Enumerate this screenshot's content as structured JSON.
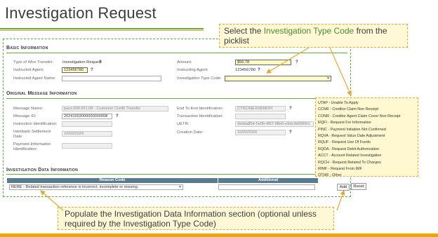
{
  "slide": {
    "title": "Investigation Request",
    "callout_top_prefix": "Select the ",
    "callout_top_highlight": "Investigation Type Code",
    "callout_top_suffix": " from the picklist",
    "callout_bottom": "Populate the Investigation Data Information section (optional unless required by the Investigation Type Code)"
  },
  "basic": {
    "title": "Basic Information",
    "type_label": "Type of Wire Transfer:",
    "type_value": "Investigation Request",
    "instructed_agent_label": "Instructed Agent:",
    "instructed_agent_value": "123456780",
    "instructed_agent_name_label": "Instructed Agent Name:",
    "amount_label": "Amount:",
    "amount_value": "$56.78",
    "instructing_agent_label": "Instructing Agent:",
    "instructing_agent_value": "123456780",
    "inv_type_label": "Investigation Type Code:",
    "help": "?"
  },
  "original": {
    "title": "Original Message Information",
    "message_name_label": "Message Name:",
    "message_name_value": "pacs.008.001.08 - Customer Credit Transfer",
    "message_id_label": "Message ID:",
    "message_id_value": "20241003000000000008",
    "instr_id_label": "Instruction Identification:",
    "settlement_label": "Interbank Settlement Date:",
    "settlement_value": "10/03/2024",
    "payment_info_label": "Payment Information Identification:",
    "e2e_label": "End To End Identification:",
    "e2e_value": "CTRCINEXDEMOFI",
    "txn_id_label": "Transaction Identification:",
    "uetr_label": "UETR:",
    "uetr_value": "9ebba854-5e0b-4f67-98e6-e9dc3b6f30b1",
    "creation_label": "Creation Date:",
    "creation_value": "10/03/2024"
  },
  "investigation": {
    "title": "Investigation Data Information",
    "col_reason": "Reason Code",
    "col_additional": "Additional",
    "reason_value": "RERE - Related transaction reference is incorrect, incomplete or missing.",
    "add_label": "Add",
    "reset_label": "Reset"
  },
  "picklist": [
    "UTAP - Unable To Apply",
    "CCNR - Creditor Claim Non Receipt",
    "CONR - Creditor Agent Claim Cover Non Receipt",
    "RQFI - Request For Information",
    "PINC - Payment Initiation Not Confirmed",
    "RQVA - Request Value Date Adjustment",
    "RQUF - Request Use Of Funds",
    "RQDA - Request Debit Authorization",
    "ACCT - Account Related Investigation",
    "RQCH - Request Related To Charges",
    "RIMF - Request From IMF",
    "OTHR - Other"
  ],
  "colors": {
    "accent_green": "#6aaa3a",
    "accent_orange": "#e2a83a",
    "grid_header": "#5a7a8e"
  }
}
